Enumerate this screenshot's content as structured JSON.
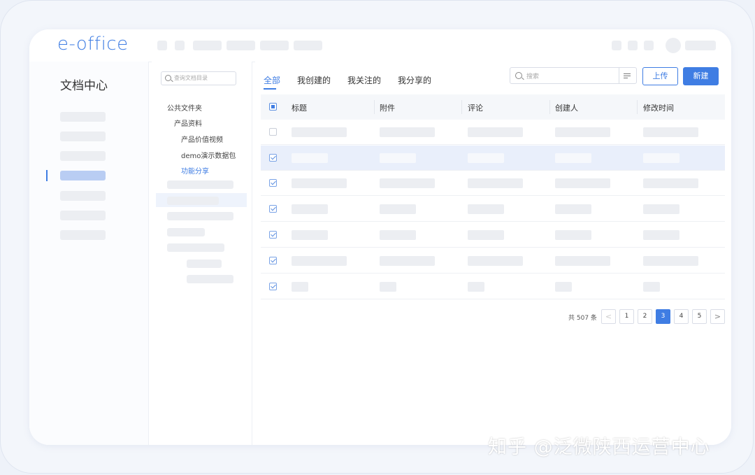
{
  "app": {
    "logo": "e-office"
  },
  "left_nav": {
    "title": "文档中心"
  },
  "tree": {
    "search_placeholder": "查询文档目录",
    "items": [
      "公共文件夹",
      "产品资料",
      "产品价值视频",
      "demo演示数据包",
      "功能分享"
    ],
    "selected": "功能分享"
  },
  "tabs": [
    {
      "label": "全部",
      "active": true
    },
    {
      "label": "我创建的",
      "active": false
    },
    {
      "label": "我关注的",
      "active": false
    },
    {
      "label": "我分享的",
      "active": false
    }
  ],
  "search": {
    "placeholder": "搜索"
  },
  "buttons": {
    "upload": "上传",
    "new": "新建"
  },
  "table": {
    "columns": [
      "标题",
      "附件",
      "评论",
      "创建人",
      "修改时间"
    ],
    "rows": [
      {
        "checked": false,
        "selected": false
      },
      {
        "checked": true,
        "selected": true
      },
      {
        "checked": true,
        "selected": false
      },
      {
        "checked": true,
        "selected": false
      },
      {
        "checked": true,
        "selected": false
      },
      {
        "checked": true,
        "selected": false
      },
      {
        "checked": true,
        "selected": false
      }
    ]
  },
  "pagination": {
    "total": "共 507 条",
    "pages": [
      "1",
      "2",
      "3",
      "4",
      "5"
    ],
    "current": "3",
    "prev": "<",
    "next": ">"
  },
  "watermark": "知乎 @泛微陕西运营中心",
  "colors": {
    "accent": "#3f7de3",
    "placeholder": "#eceef2",
    "row_selected": "#e9effb"
  }
}
